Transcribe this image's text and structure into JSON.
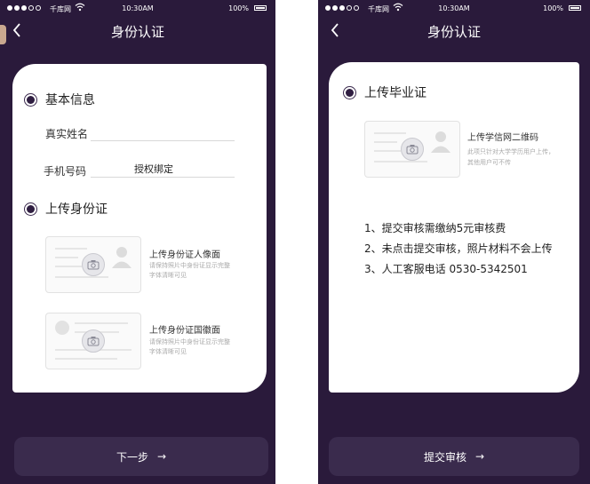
{
  "status_bar": {
    "carrier": "千库网",
    "time": "10:30AM",
    "battery": "100%"
  },
  "left_screen": {
    "nav_title": "身份认证",
    "basic_info": {
      "section_title": "基本信息",
      "name_label": "真实姓名",
      "phone_label": "手机号码",
      "bind_label": "授权绑定"
    },
    "id_upload": {
      "section_title": "上传身份证",
      "front": {
        "title": "上传身份证人像面",
        "hint_line1": "请保持照片中身份证显示完整",
        "hint_line2": "字体清晰可见"
      },
      "back": {
        "title": "上传身份证国徽面",
        "hint_line1": "请保持照片中身份证显示完整",
        "hint_line2": "字体清晰可见"
      }
    },
    "next_button": "下一步",
    "next_arrow": "→"
  },
  "right_screen": {
    "nav_title": "身份认证",
    "section_title": "上传毕业证",
    "qr_upload": {
      "title": "上传学信网二维码",
      "hint_line1": "此项只针对大学学历用户上传，",
      "hint_line2": "其他用户可不传"
    },
    "notes": [
      "1、提交审核需缴纳5元审核费",
      "2、未点击提交审核，照片材料不会上传",
      "3、人工客服电话 0530-5342501"
    ],
    "submit_button": "提交审核",
    "submit_arrow": "→"
  },
  "icons": {
    "back": "chevron-left-icon",
    "camera": "camera-icon",
    "person": "person-silhouette-icon"
  },
  "colors": {
    "background_dark": "#2a1a3b",
    "button": "#3a2b4d",
    "card": "#ffffff"
  }
}
